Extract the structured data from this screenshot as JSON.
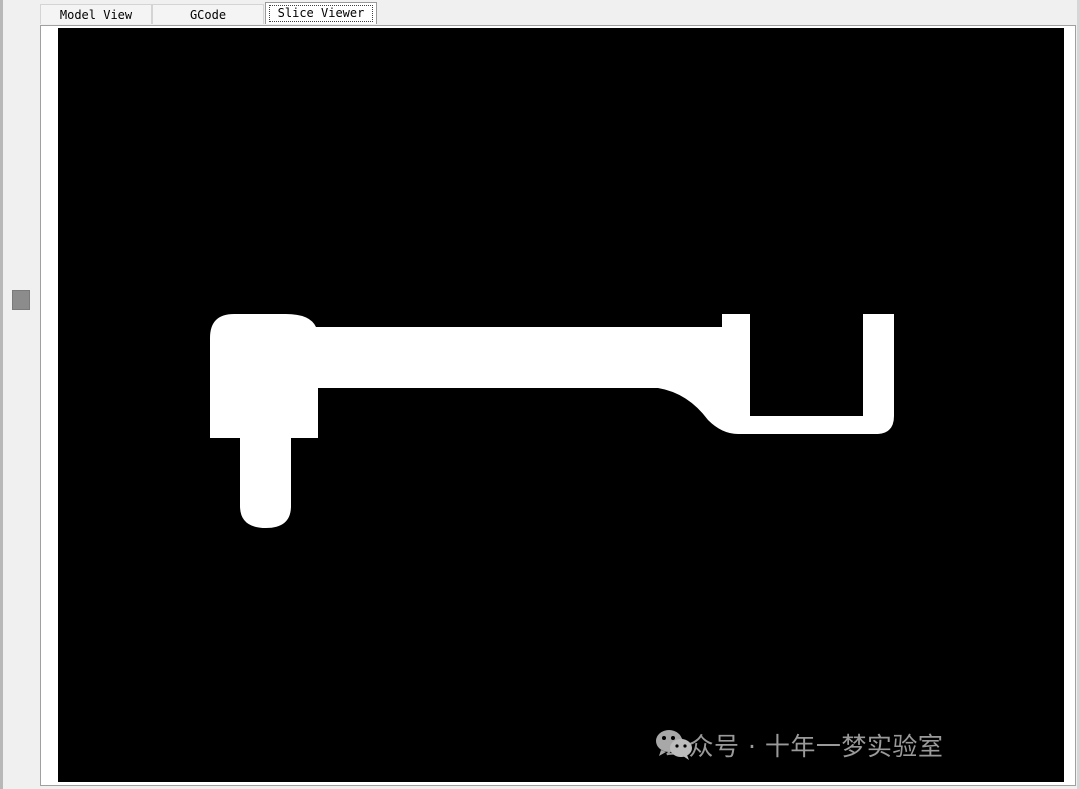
{
  "tabs": [
    {
      "label": "Model View",
      "selected": false
    },
    {
      "label": "GCode",
      "selected": false
    },
    {
      "label": "Slice Viewer",
      "selected": true
    }
  ],
  "viewer": {
    "background_color": "#000000",
    "slice_fill_color": "#ffffff"
  },
  "watermark": {
    "icon": "wechat-icon",
    "text": "公众号 · 十年一梦实验室"
  }
}
